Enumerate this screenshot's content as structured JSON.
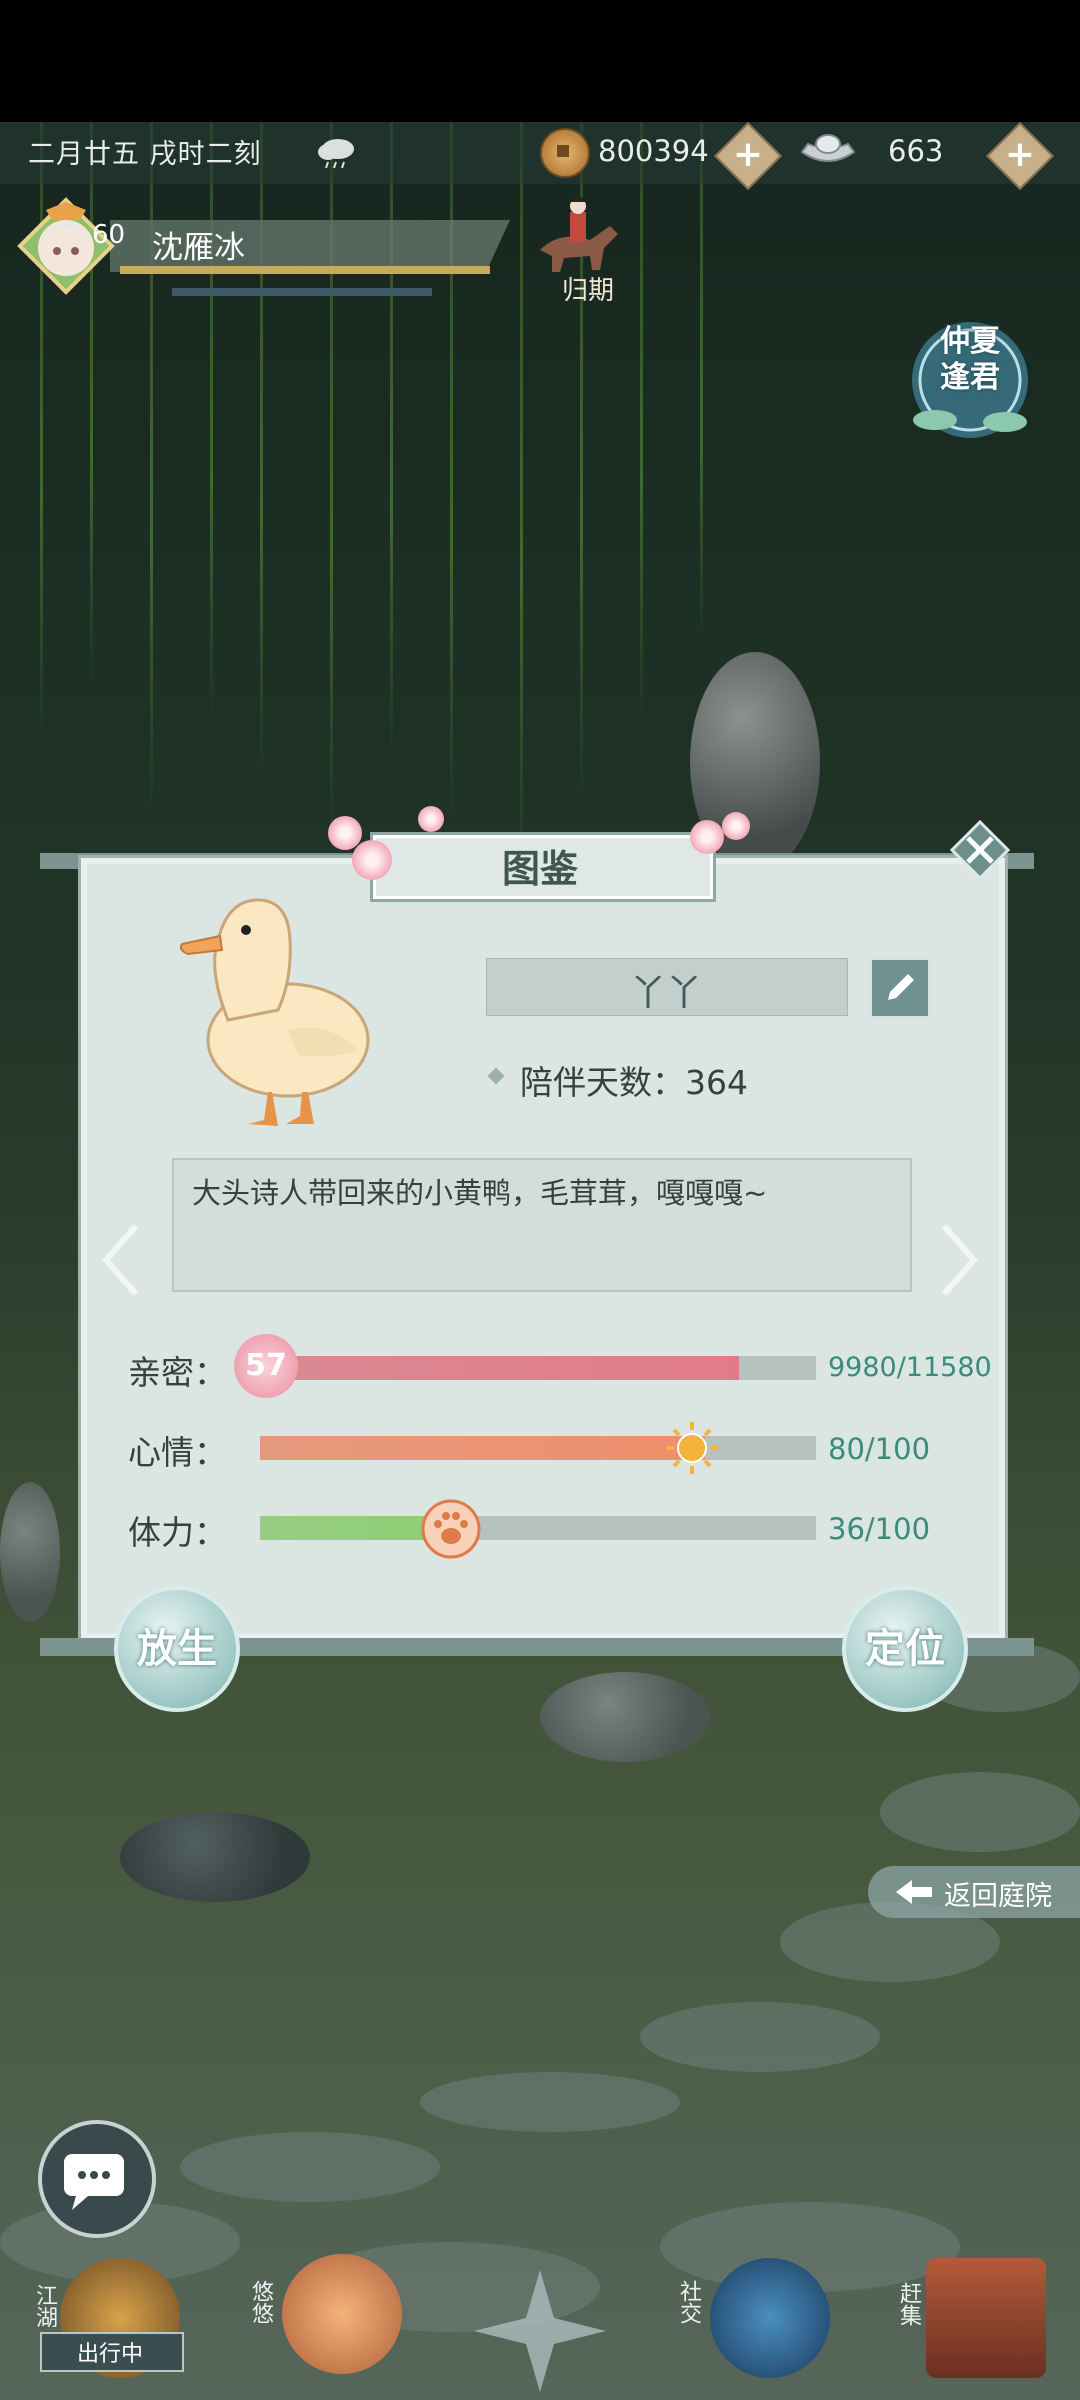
{
  "status_bar": {
    "date_time": "二月廿五  戌时二刻",
    "weather_icon": "cloud-rain-icon",
    "copper_coins": "800394",
    "silver": "663",
    "add_label": "+"
  },
  "player": {
    "level": "60",
    "name": "沈雁冰"
  },
  "travel": {
    "label": "归期"
  },
  "event_badge": {
    "text": "仲夏逢君"
  },
  "panel": {
    "title": "图鉴",
    "pet_name": "丫丫",
    "days_label": "陪伴天数：364",
    "description": "大头诗人带回来的小黄鸭，毛茸茸，嘎嘎嘎~",
    "stats": [
      {
        "label": "亲密：",
        "value_text": "9980/11580",
        "fraction": 0.862,
        "badge": "57",
        "color": "#e27b88"
      },
      {
        "label": "心情：",
        "value_text": "80/100",
        "fraction": 0.8,
        "color": "#f08f6c"
      },
      {
        "label": "体力：",
        "value_text": "36/100",
        "fraction": 0.36,
        "color": "#8fcf72"
      }
    ],
    "release_btn": "放生",
    "locate_btn": "定位"
  },
  "return_yard": "返回庭院",
  "bottom_nav": {
    "jianghu": "江湖",
    "status_tag": "出行中",
    "youyou": "悠悠",
    "social": "社交",
    "market": "赶集"
  }
}
